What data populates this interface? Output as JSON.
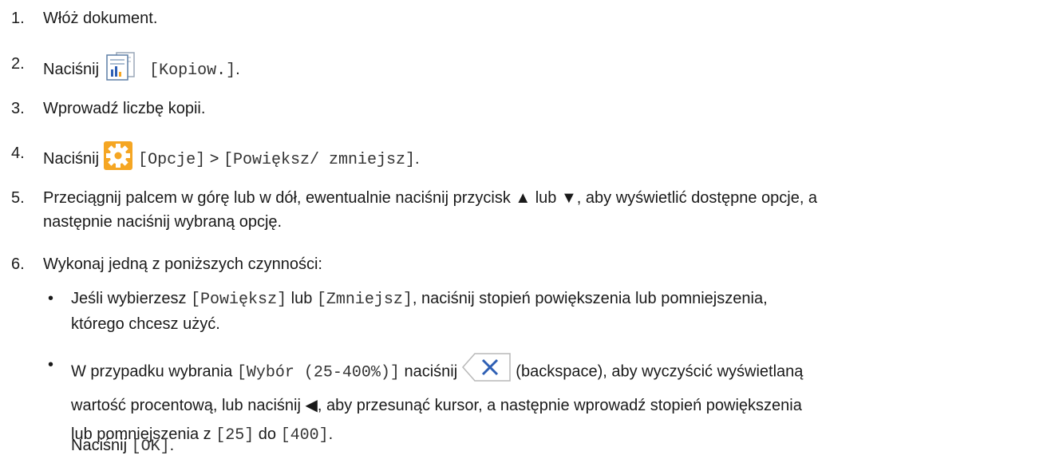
{
  "steps": [
    {
      "num": "1.",
      "text": "Włóż dokument."
    },
    {
      "num": "2.",
      "pre": "Naciśnij ",
      "code": "[Kopiow.]",
      "post": ".",
      "icon": "copy-document-icon"
    },
    {
      "num": "3.",
      "text": "Wprowadź liczbę kopii."
    },
    {
      "num": "4.",
      "pre": "Naciśnij ",
      "code1": "[Opcje]",
      "sep": " > ",
      "code2": "[Powiększ/ zmniejsz]",
      "post": ".",
      "icon": "settings-gear-icon"
    },
    {
      "num": "5.",
      "line1": "Przeciągnij palcem w górę lub w dół, ewentualnie naciśnij przycisk ▲ lub ▼, aby wyświetlić dostępne opcje, a",
      "line2": "następnie naciśnij wybraną opcję."
    },
    {
      "num": "6.",
      "text": "Wykonaj jedną z poniższych czynności:"
    }
  ],
  "bullets": [
    {
      "dot": "•",
      "pre": "Jeśli wybierzesz ",
      "code1": "[Powiększ]",
      "mid": " lub ",
      "code2": "[Zmniejsz]",
      "post": ", naciśnij stopień powiększenia lub pomniejszenia,",
      "line2": "którego chcesz użyć."
    },
    {
      "dot": "•",
      "pre": "W przypadku wybrania ",
      "code1": "[Wybór (25-400%)]",
      "mid": " naciśnij ",
      "post": " (backspace), aby wyczyścić wyświetlaną",
      "line2": "wartość procentową, lub naciśnij ◀, aby przesunąć kursor, a następnie wprowadź stopień powiększenia",
      "line3pre": "lub pomniejszenia z ",
      "code2": "[25]",
      "line3mid": " do ",
      "code3": "[400]",
      "line3post": ".",
      "icon": "backspace-icon"
    }
  ],
  "final": {
    "pre": "Naciśnij ",
    "code": "[OK]",
    "post": "."
  },
  "colors": {
    "gear_bg": "#f5a623",
    "icon_bar_blue": "#2e5fb4",
    "icon_bar_orange": "#f5a623",
    "backspace_x": "#2e5fb4"
  }
}
